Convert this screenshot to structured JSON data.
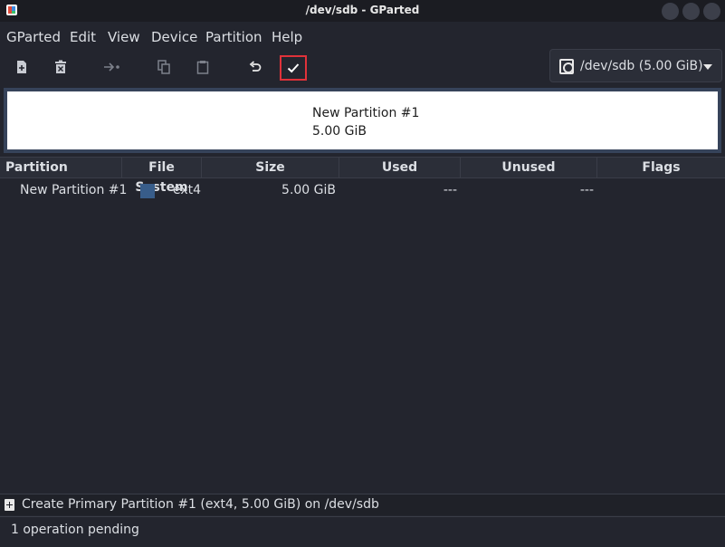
{
  "window": {
    "title": "/dev/sdb - GParted",
    "app_icon": "gparted-app-icon",
    "controls": [
      "minimize",
      "maximize",
      "close"
    ]
  },
  "menubar": {
    "items": [
      "GParted",
      "Edit",
      "View",
      "Device",
      "Partition",
      "Help"
    ]
  },
  "toolbar": {
    "buttons": [
      {
        "name": "new-partition",
        "icon": "document-new-icon",
        "enabled": true
      },
      {
        "name": "delete-partition",
        "icon": "trash-icon",
        "enabled": true
      },
      {
        "name": "resize-move",
        "icon": "arrow-right-icon",
        "enabled": false
      },
      {
        "name": "copy",
        "icon": "copy-icon",
        "enabled": false
      },
      {
        "name": "paste",
        "icon": "clipboard-icon",
        "enabled": false
      },
      {
        "name": "undo",
        "icon": "undo-icon",
        "enabled": true
      },
      {
        "name": "apply",
        "icon": "checkmark-icon",
        "enabled": true,
        "highlighted": true
      }
    ]
  },
  "device_selector": {
    "icon": "harddisk-icon",
    "label": "/dev/sdb (5.00 GiB)"
  },
  "partition_map": {
    "partitions": [
      {
        "name": "New Partition #1",
        "size": "5.00 GiB"
      }
    ]
  },
  "table": {
    "columns": [
      "Partition",
      "File System",
      "Size",
      "Used",
      "Unused",
      "Flags"
    ],
    "rows": [
      {
        "partition": "New Partition #1",
        "filesystem": "ext4",
        "fs_color": "#385d8a",
        "size": "5.00 GiB",
        "used": "---",
        "unused": "---",
        "flags": ""
      }
    ]
  },
  "operations": {
    "items": [
      {
        "icon": "new-partition-icon",
        "text": "Create Primary Partition #1 (ext4, 5.00 GiB) on /dev/sdb"
      }
    ]
  },
  "status": {
    "text": "1 operation pending"
  },
  "colors": {
    "background": "#23252e",
    "apply_highlight": "#e0323a",
    "ext4": "#385d8a"
  }
}
